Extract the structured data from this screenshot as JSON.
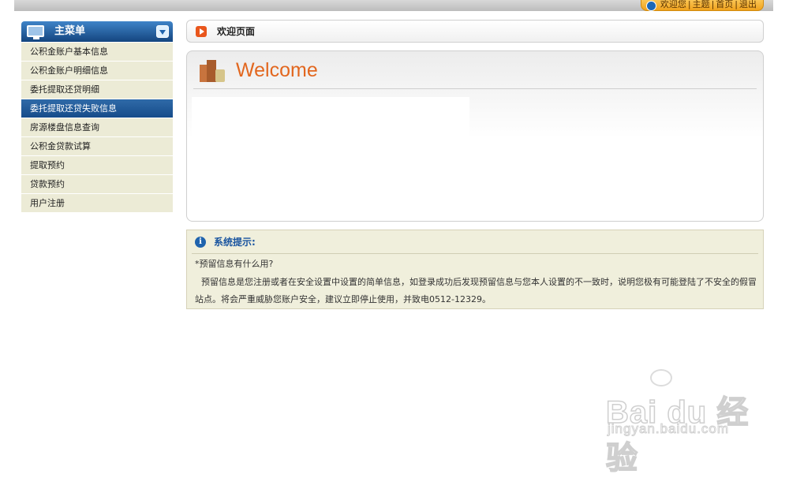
{
  "header": {
    "links": [
      "欢迎您",
      "主题",
      "首页",
      "退出"
    ]
  },
  "sidebar": {
    "title": "主菜单",
    "items": [
      {
        "label": "公积金账户基本信息",
        "active": false
      },
      {
        "label": "公积金账户明细信息",
        "active": false
      },
      {
        "label": "委托提取还贷明细",
        "active": false
      },
      {
        "label": "委托提取还贷失败信息",
        "active": true
      },
      {
        "label": "房源楼盘信息查询",
        "active": false
      },
      {
        "label": "公积金贷款试算",
        "active": false
      },
      {
        "label": "提取预约",
        "active": false
      },
      {
        "label": "贷款预约",
        "active": false
      },
      {
        "label": "用户注册",
        "active": false
      }
    ]
  },
  "tab": {
    "title": "欢迎页面"
  },
  "welcome": {
    "title": "Welcome"
  },
  "notice": {
    "title": "系统提示:",
    "question": "*预留信息有什么用?",
    "answer": "预留信息是您注册或者在安全设置中设置的简单信息，如登录成功后发现预留信息与您本人设置的不一致时，说明您极有可能登陆了不安全的假冒站点。将会严重威胁您账户安全，建议立即停止使用，并致电0512-12329。"
  },
  "watermark": {
    "brand": "Bai du 经验",
    "url": "jingyan.baidu.com"
  },
  "colors": {
    "accent": "#1f63ad",
    "orange": "#e2671f",
    "menu_bg": "#ecebd6",
    "notice_bg": "#f0efdc"
  }
}
